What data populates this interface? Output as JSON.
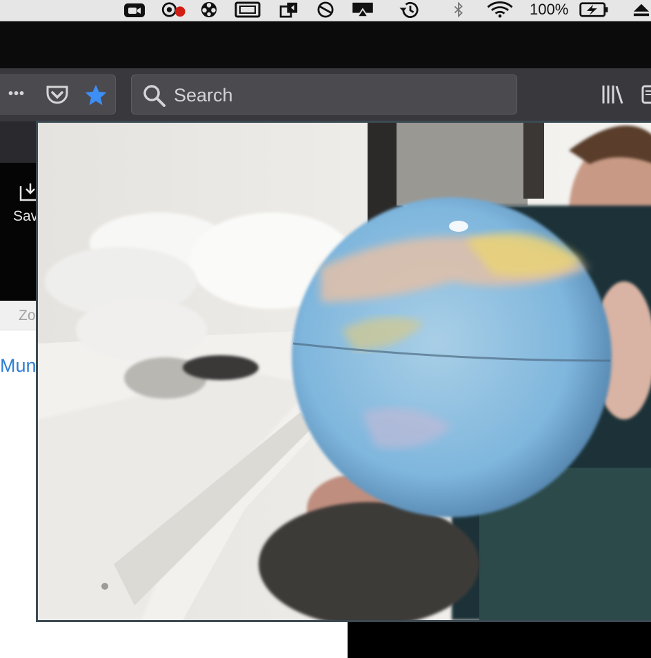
{
  "menubar": {
    "icons": [
      "zoom-video-icon",
      "record-icon",
      "reel-icon",
      "window-icon",
      "dropbox-sync-icon",
      "no-entry-icon",
      "airplay-icon",
      "time-machine-icon",
      "bluetooth-icon",
      "wifi-icon",
      "battery-charging-icon",
      "eject-icon"
    ],
    "battery_percent": "100%"
  },
  "browser": {
    "toolbar": {
      "overflow_label": "•••",
      "search_placeholder": "Search"
    }
  },
  "page": {
    "save_label": "Sav",
    "zoom_tab_label": "Zo",
    "link_text": "Mun"
  },
  "colors": {
    "menubar_bg": "#e6e6e6",
    "toolbar_bg": "#38383d",
    "bookmark_star": "#3d8ef5",
    "link": "#2f7fd4",
    "video_border": "#3c4a52"
  }
}
